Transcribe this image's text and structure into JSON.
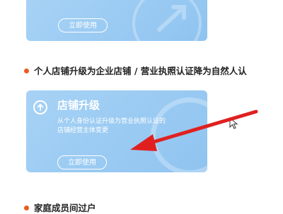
{
  "top_card": {
    "button_label": "立即使用"
  },
  "section_upgrade": {
    "heading": "个人店铺升级为企业店铺 / 营业执照认证降为自然人认"
  },
  "upgrade_card": {
    "title": "店铺升级",
    "description": "从个人身份认证升级为营业执照认证的店铺经营主体变更",
    "button_label": "立即使用"
  },
  "section_family": {
    "heading": "家庭成员间过户"
  },
  "colors": {
    "card_bg": "#97c9f2",
    "bullet": "#ee5a22",
    "annotation_arrow": "#e02020"
  },
  "icons": [
    "upload-arrow-icon",
    "mouse-cursor-icon",
    "annotation-arrow"
  ]
}
